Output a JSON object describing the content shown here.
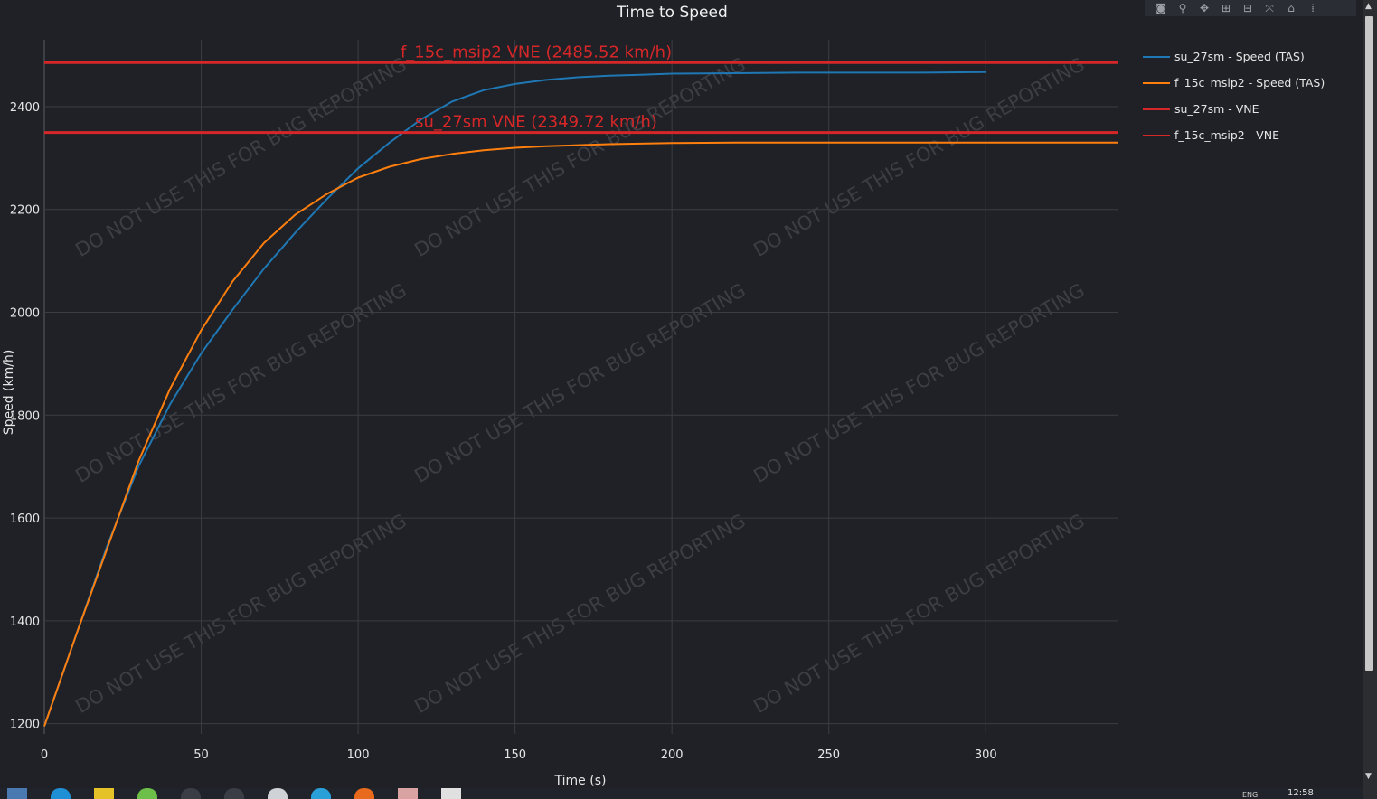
{
  "title": "Time to Speed",
  "modebar": {
    "icons": [
      "camera-icon",
      "zoom-icon",
      "pan-icon",
      "zoom-in-icon",
      "zoom-out-icon",
      "autoscale-icon",
      "home-icon",
      "plotly-icon"
    ]
  },
  "legend": [
    {
      "label": "su_27sm - Speed (TAS)",
      "color": "#1f77b4"
    },
    {
      "label": "f_15c_msip2 - Speed (TAS)",
      "color": "#ff7f0e"
    },
    {
      "label": "su_27sm - VNE",
      "color": "#d62728"
    },
    {
      "label": "f_15c_msip2 - VNE",
      "color": "#d62728"
    }
  ],
  "chart_data": {
    "type": "line",
    "title": "Time to Speed",
    "xlabel": "Time (s)",
    "ylabel": "Speed (km/h)",
    "xlim": [
      0,
      342
    ],
    "ylim": [
      1180,
      2530
    ],
    "xticks": [
      0,
      50,
      100,
      150,
      200,
      250,
      300
    ],
    "yticks": [
      1200,
      1400,
      1600,
      2000,
      1800,
      2200,
      2400
    ],
    "grid": true,
    "legend_position": "top-right",
    "series": [
      {
        "name": "su_27sm - Speed (TAS)",
        "color": "#1f77b4",
        "x": [
          0,
          10,
          20,
          30,
          40,
          50,
          60,
          70,
          80,
          90,
          100,
          110,
          120,
          130,
          140,
          150,
          160,
          170,
          180,
          190,
          200,
          220,
          240,
          260,
          280,
          300
        ],
        "y": [
          1195,
          1370,
          1545,
          1700,
          1820,
          1920,
          2005,
          2085,
          2155,
          2220,
          2280,
          2330,
          2375,
          2410,
          2432,
          2444,
          2452,
          2457,
          2460,
          2462,
          2464,
          2465,
          2466,
          2466,
          2466,
          2467
        ]
      },
      {
        "name": "f_15c_msip2 - Speed (TAS)",
        "color": "#ff7f0e",
        "x": [
          0,
          10,
          20,
          30,
          40,
          50,
          60,
          70,
          80,
          90,
          100,
          110,
          120,
          130,
          140,
          150,
          160,
          180,
          200,
          220,
          240,
          260,
          280,
          300,
          342
        ],
        "y": [
          1195,
          1370,
          1540,
          1710,
          1850,
          1965,
          2060,
          2135,
          2190,
          2230,
          2262,
          2283,
          2298,
          2308,
          2315,
          2320,
          2323,
          2327,
          2329,
          2330,
          2330,
          2330,
          2330,
          2330,
          2330
        ]
      },
      {
        "name": "su_27sm - VNE",
        "color": "#d62728",
        "x": [
          0,
          342
        ],
        "y": [
          2349.72,
          2349.72
        ]
      },
      {
        "name": "f_15c_msip2 - VNE",
        "color": "#d62728",
        "x": [
          0,
          342
        ],
        "y": [
          2485.52,
          2485.52
        ]
      }
    ],
    "annotations": [
      {
        "text": "f_15c_msip2 VNE (2485.52 km/h)",
        "x": 170,
        "y": 2485.52,
        "color": "#d62728"
      },
      {
        "text": "su_27sm VNE (2349.72 km/h)",
        "x": 170,
        "y": 2349.72,
        "color": "#d62728"
      }
    ]
  },
  "watermark": "DO NOT USE THIS FOR BUG REPORTING",
  "taskbar": {
    "clock": "12:58",
    "lang": "ENG",
    "icons": [
      "calculator-icon",
      "edge-icon",
      "app-icon",
      "smiley-icon",
      "m-icon",
      "headphones-icon",
      "steam-icon",
      "telegram-icon",
      "origin-icon",
      "tool-icon",
      "window-icon"
    ]
  }
}
